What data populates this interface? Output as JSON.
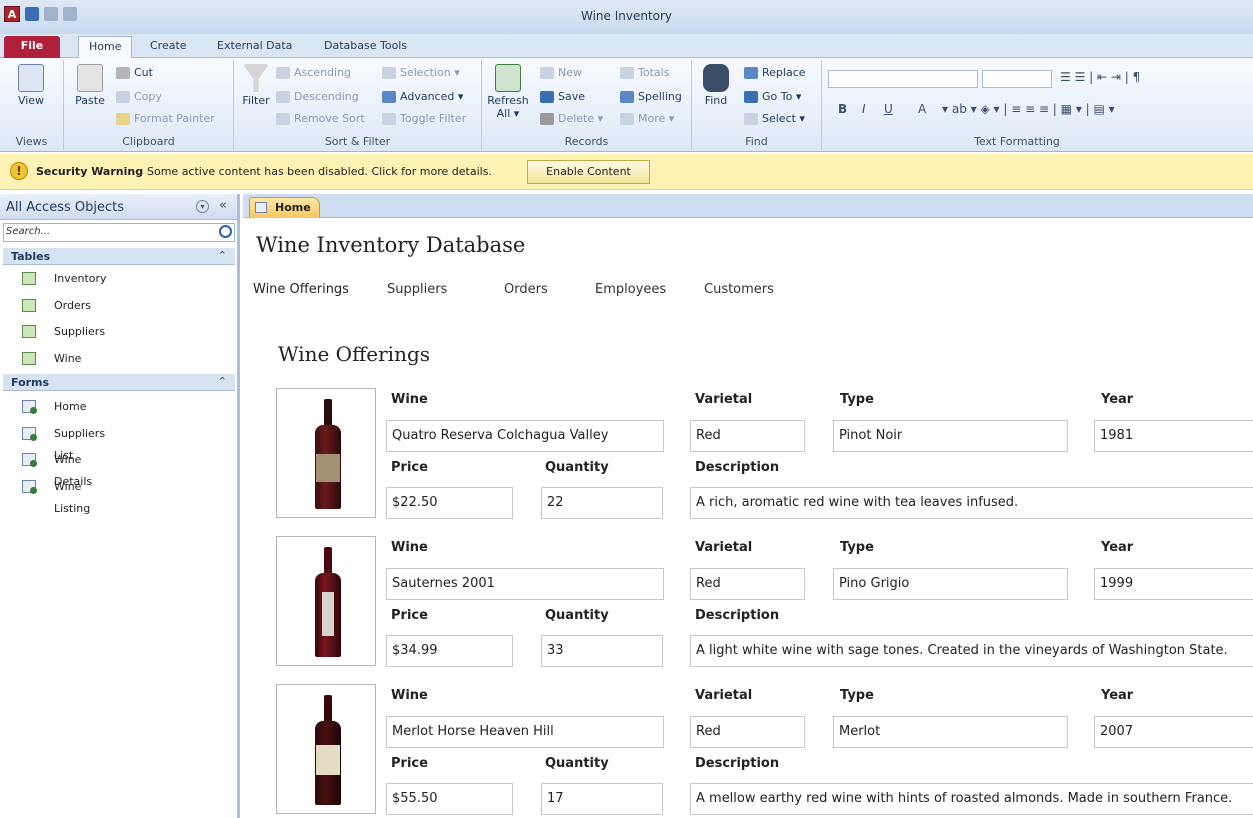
{
  "window": {
    "title": "Wine Inventory"
  },
  "menu_tabs": [
    "File",
    "Home",
    "Create",
    "External Data",
    "Database Tools"
  ],
  "ribbon": {
    "views": {
      "view_label": "View",
      "group_label": "Views"
    },
    "clipboard": {
      "paste": "Paste",
      "cut": "Cut",
      "copy": "Copy",
      "format_painter": "Format Painter",
      "group_label": "Clipboard"
    },
    "sort_filter": {
      "filter": "Filter",
      "ascending": "Ascending",
      "descending": "Descending",
      "remove_sort": "Remove Sort",
      "selection": "Selection",
      "advanced": "Advanced",
      "toggle_filter": "Toggle Filter",
      "group_label": "Sort & Filter"
    },
    "records": {
      "refresh": "Refresh",
      "refresh_all": "All",
      "new": "New",
      "save": "Save",
      "delete": "Delete",
      "totals": "Totals",
      "spelling": "Spelling",
      "more": "More",
      "group_label": "Records"
    },
    "find": {
      "find": "Find",
      "replace": "Replace",
      "goto": "Go To",
      "select": "Select",
      "group_label": "Find"
    },
    "text_formatting": {
      "bold": "B",
      "italic": "I",
      "underline": "U",
      "font_color": "A",
      "group_label": "Text Formatting"
    }
  },
  "security": {
    "title": "Security Warning",
    "message": "Some active content has been disabled. Click for more details.",
    "button": "Enable Content"
  },
  "nav_pane": {
    "header": "All Access Objects",
    "search_placeholder": "Search...",
    "tables_label": "Tables",
    "tables": [
      "Inventory",
      "Orders",
      "Suppliers",
      "Wine"
    ],
    "forms_label": "Forms",
    "forms": [
      "Home",
      "Suppliers List",
      "Wine Details",
      "Wine Listing"
    ]
  },
  "doc_tab": "Home",
  "form": {
    "title": "Wine Inventory Database",
    "nav": [
      "Wine Offerings",
      "Suppliers",
      "Orders",
      "Employees",
      "Customers"
    ],
    "section_title": "Wine Offerings",
    "labels": {
      "wine": "Wine",
      "varietal": "Varietal",
      "type": "Type",
      "year": "Year",
      "price": "Price",
      "quantity": "Quantity",
      "description": "Description"
    },
    "records": [
      {
        "wine": "Quatro Reserva Colchagua Valley",
        "varietal": "Red",
        "type": "Pinot Noir",
        "year": "1981",
        "price": "$22.50",
        "quantity": "22",
        "description": "A rich, aromatic red wine with tea leaves infused."
      },
      {
        "wine": "Sauternes 2001",
        "varietal": "Red",
        "type": "Pino Grigio",
        "year": "1999",
        "price": "$34.99",
        "quantity": "33",
        "description": "A light white wine with sage tones. Created in the vineyards of Washington State."
      },
      {
        "wine": "Merlot Horse Heaven Hill",
        "varietal": "Red",
        "type": "Merlot",
        "year": "2007",
        "price": "$55.50",
        "quantity": "17",
        "description": "A mellow earthy red wine with hints of roasted almonds. Made in southern France."
      }
    ]
  }
}
